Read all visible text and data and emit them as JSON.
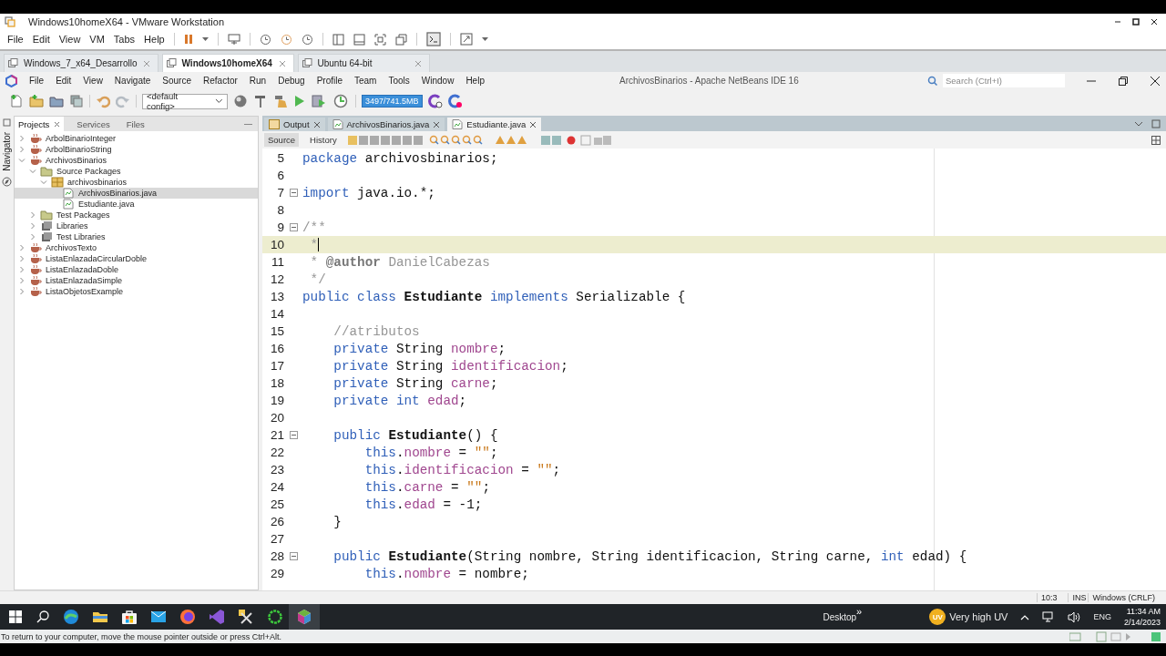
{
  "vm_window": {
    "title": "Windows10homeX64 - VMware Workstation",
    "menu": [
      "File",
      "Edit",
      "View",
      "VM",
      "Tabs",
      "Help"
    ],
    "tabs": [
      {
        "label": "Windows_7_x64_Desarrollo",
        "selected": false
      },
      {
        "label": "Windows10homeX64",
        "selected": true
      },
      {
        "label": "Ubuntu 64-bit",
        "selected": false
      }
    ],
    "status_message": "To return to your computer, move the mouse pointer outside or press Ctrl+Alt."
  },
  "ide": {
    "title": "ArchivosBinarios - Apache NetBeans IDE 16",
    "menu": [
      "File",
      "Edit",
      "View",
      "Navigate",
      "Source",
      "Refactor",
      "Run",
      "Debug",
      "Profile",
      "Team",
      "Tools",
      "Window",
      "Help"
    ],
    "search": {
      "placeholder": "Search (Ctrl+I)"
    },
    "config": "<default config>",
    "memory": "3497/741.5MB",
    "navigator": "Navigator",
    "side_tabs": [
      {
        "label": "Projects",
        "selected": true
      },
      {
        "label": "Services",
        "selected": false
      },
      {
        "label": "Files",
        "selected": false
      }
    ],
    "project_tree": [
      {
        "label": "ArbolBinarioInteger",
        "kind": "project",
        "expanded": false,
        "selected": false
      },
      {
        "label": "ArbolBinarioString",
        "kind": "project",
        "expanded": false,
        "selected": false
      },
      {
        "label": "ArchivosBinarios",
        "kind": "project",
        "expanded": true,
        "selected": false,
        "children": [
          {
            "label": "Source Packages",
            "kind": "sources",
            "expanded": true,
            "selected": false,
            "children": [
              {
                "label": "archivosbinarios",
                "kind": "package",
                "expanded": true,
                "selected": false,
                "children": [
                  {
                    "label": "ArchivosBinarios.java",
                    "kind": "java",
                    "selected": true
                  },
                  {
                    "label": "Estudiante.java",
                    "kind": "java",
                    "selected": false
                  }
                ]
              }
            ]
          },
          {
            "label": "Test Packages",
            "kind": "sources",
            "expanded": false,
            "selected": false
          },
          {
            "label": "Libraries",
            "kind": "library",
            "expanded": false,
            "selected": false
          },
          {
            "label": "Test Libraries",
            "kind": "library",
            "expanded": false,
            "selected": false
          }
        ]
      },
      {
        "label": "ArchivosTexto",
        "kind": "project",
        "expanded": false,
        "selected": false
      },
      {
        "label": "ListaEnlazadaCircularDoble",
        "kind": "project",
        "expanded": false,
        "selected": false
      },
      {
        "label": "ListaEnlazadaDoble",
        "kind": "project",
        "expanded": false,
        "selected": false
      },
      {
        "label": "ListaEnlazadaSimple",
        "kind": "project",
        "expanded": false,
        "selected": false
      },
      {
        "label": "ListaObjetosExample",
        "kind": "project",
        "expanded": false,
        "selected": false
      }
    ],
    "editor_tabs": [
      {
        "label": "Output",
        "kind": "output",
        "selected": false
      },
      {
        "label": "ArchivosBinarios.java",
        "kind": "java",
        "selected": false
      },
      {
        "label": "Estudiante.java",
        "kind": "java",
        "selected": true
      }
    ],
    "editor_modes": [
      {
        "label": "Source",
        "selected": true
      },
      {
        "label": "History",
        "selected": false
      }
    ],
    "code_lines": [
      {
        "number": "5",
        "fold": false,
        "current": false,
        "tokens": [
          {
            "t": "package",
            "kind": "kw"
          },
          {
            "t": " archivosbinarios;",
            "kind": "plain"
          }
        ]
      },
      {
        "number": "6",
        "fold": false,
        "current": false
      },
      {
        "number": "7",
        "fold": true,
        "current": false,
        "tokens": [
          {
            "t": "import",
            "kind": "kw"
          },
          {
            "t": " java.io.*;",
            "kind": "plain"
          }
        ]
      },
      {
        "number": "8",
        "fold": false,
        "current": false
      },
      {
        "number": "9",
        "fold": true,
        "current": false,
        "tokens": [
          {
            "t": "/**",
            "kind": "comment"
          }
        ]
      },
      {
        "number": "10",
        "fold": false,
        "current": true,
        "tokens": [
          {
            "t": " *",
            "kind": "comment"
          }
        ]
      },
      {
        "number": "11",
        "fold": false,
        "current": false,
        "tokens": [
          {
            "t": " * ",
            "kind": "comment"
          },
          {
            "t": "@author",
            "kind": "tag"
          },
          {
            "t": " DanielCabezas",
            "kind": "comment"
          }
        ]
      },
      {
        "number": "12",
        "fold": false,
        "current": false,
        "tokens": [
          {
            "t": " */",
            "kind": "comment"
          }
        ]
      },
      {
        "number": "13",
        "fold": false,
        "current": false,
        "tokens": [
          {
            "t": "public class ",
            "kind": "kw"
          },
          {
            "t": "Estudiante ",
            "kind": "bold"
          },
          {
            "t": "implements",
            "kind": "kw"
          },
          {
            "t": " Serializable {",
            "kind": "plain"
          }
        ]
      },
      {
        "number": "14",
        "fold": false,
        "current": false
      },
      {
        "number": "15",
        "fold": false,
        "current": false,
        "tokens": [
          {
            "t": "    //atributos",
            "kind": "comment"
          }
        ]
      },
      {
        "number": "16",
        "fold": false,
        "current": false,
        "tokens": [
          {
            "t": "    private",
            "kind": "kw"
          },
          {
            "t": " String ",
            "kind": "plain"
          },
          {
            "t": "nombre",
            "kind": "field"
          },
          {
            "t": ";",
            "kind": "plain"
          }
        ]
      },
      {
        "number": "17",
        "fold": false,
        "current": false,
        "tokens": [
          {
            "t": "    private",
            "kind": "kw"
          },
          {
            "t": " String ",
            "kind": "plain"
          },
          {
            "t": "identificacion",
            "kind": "field"
          },
          {
            "t": ";",
            "kind": "plain"
          }
        ]
      },
      {
        "number": "18",
        "fold": false,
        "current": false,
        "tokens": [
          {
            "t": "    private",
            "kind": "kw"
          },
          {
            "t": " String ",
            "kind": "plain"
          },
          {
            "t": "carne",
            "kind": "field"
          },
          {
            "t": ";",
            "kind": "plain"
          }
        ]
      },
      {
        "number": "19",
        "fold": false,
        "current": false,
        "tokens": [
          {
            "t": "    private int ",
            "kind": "kw"
          },
          {
            "t": "edad",
            "kind": "field"
          },
          {
            "t": ";",
            "kind": "plain"
          }
        ]
      },
      {
        "number": "20",
        "fold": false,
        "current": false
      },
      {
        "number": "21",
        "fold": true,
        "current": false,
        "tokens": [
          {
            "t": "    public ",
            "kind": "kw"
          },
          {
            "t": "Estudiante",
            "kind": "bold"
          },
          {
            "t": "() {",
            "kind": "plain"
          }
        ]
      },
      {
        "number": "22",
        "fold": false,
        "current": false,
        "tokens": [
          {
            "t": "        this",
            "kind": "kw"
          },
          {
            "t": ".",
            "kind": "plain"
          },
          {
            "t": "nombre",
            "kind": "field"
          },
          {
            "t": " = ",
            "kind": "plain"
          },
          {
            "t": "\"\"",
            "kind": "string"
          },
          {
            "t": ";",
            "kind": "plain"
          }
        ]
      },
      {
        "number": "23",
        "fold": false,
        "current": false,
        "tokens": [
          {
            "t": "        this",
            "kind": "kw"
          },
          {
            "t": ".",
            "kind": "plain"
          },
          {
            "t": "identificacion",
            "kind": "field"
          },
          {
            "t": " = ",
            "kind": "plain"
          },
          {
            "t": "\"\"",
            "kind": "string"
          },
          {
            "t": ";",
            "kind": "plain"
          }
        ]
      },
      {
        "number": "24",
        "fold": false,
        "current": false,
        "tokens": [
          {
            "t": "        this",
            "kind": "kw"
          },
          {
            "t": ".",
            "kind": "plain"
          },
          {
            "t": "carne",
            "kind": "field"
          },
          {
            "t": " = ",
            "kind": "plain"
          },
          {
            "t": "\"\"",
            "kind": "string"
          },
          {
            "t": ";",
            "kind": "plain"
          }
        ]
      },
      {
        "number": "25",
        "fold": false,
        "current": false,
        "tokens": [
          {
            "t": "        this",
            "kind": "kw"
          },
          {
            "t": ".",
            "kind": "plain"
          },
          {
            "t": "edad",
            "kind": "field"
          },
          {
            "t": " = -1;",
            "kind": "plain"
          }
        ]
      },
      {
        "number": "26",
        "fold": false,
        "current": false,
        "tokens": [
          {
            "t": "    }",
            "kind": "plain"
          }
        ]
      },
      {
        "number": "27",
        "fold": false,
        "current": false
      },
      {
        "number": "28",
        "fold": true,
        "current": false,
        "tokens": [
          {
            "t": "    public ",
            "kind": "kw"
          },
          {
            "t": "Estudiante",
            "kind": "bold"
          },
          {
            "t": "(String nombre, String identificacion, String carne, ",
            "kind": "plain"
          },
          {
            "t": "int",
            "kind": "kw"
          },
          {
            "t": " edad) {",
            "kind": "plain"
          }
        ]
      },
      {
        "number": "29",
        "fold": false,
        "current": false,
        "tokens": [
          {
            "t": "        this",
            "kind": "kw"
          },
          {
            "t": ".",
            "kind": "plain"
          },
          {
            "t": "nombre",
            "kind": "field"
          },
          {
            "t": " = nombre;",
            "kind": "plain"
          }
        ]
      }
    ],
    "status": {
      "position": "10:3",
      "mode": "INS",
      "line_endings": "Windows (CRLF)"
    }
  },
  "taskbar": {
    "desktop": "Desktop",
    "chevron": "»",
    "weather": "Very high UV",
    "weather_badge": "UV",
    "language": "ENG",
    "time": "11:34 AM",
    "date": "2/14/2023"
  }
}
